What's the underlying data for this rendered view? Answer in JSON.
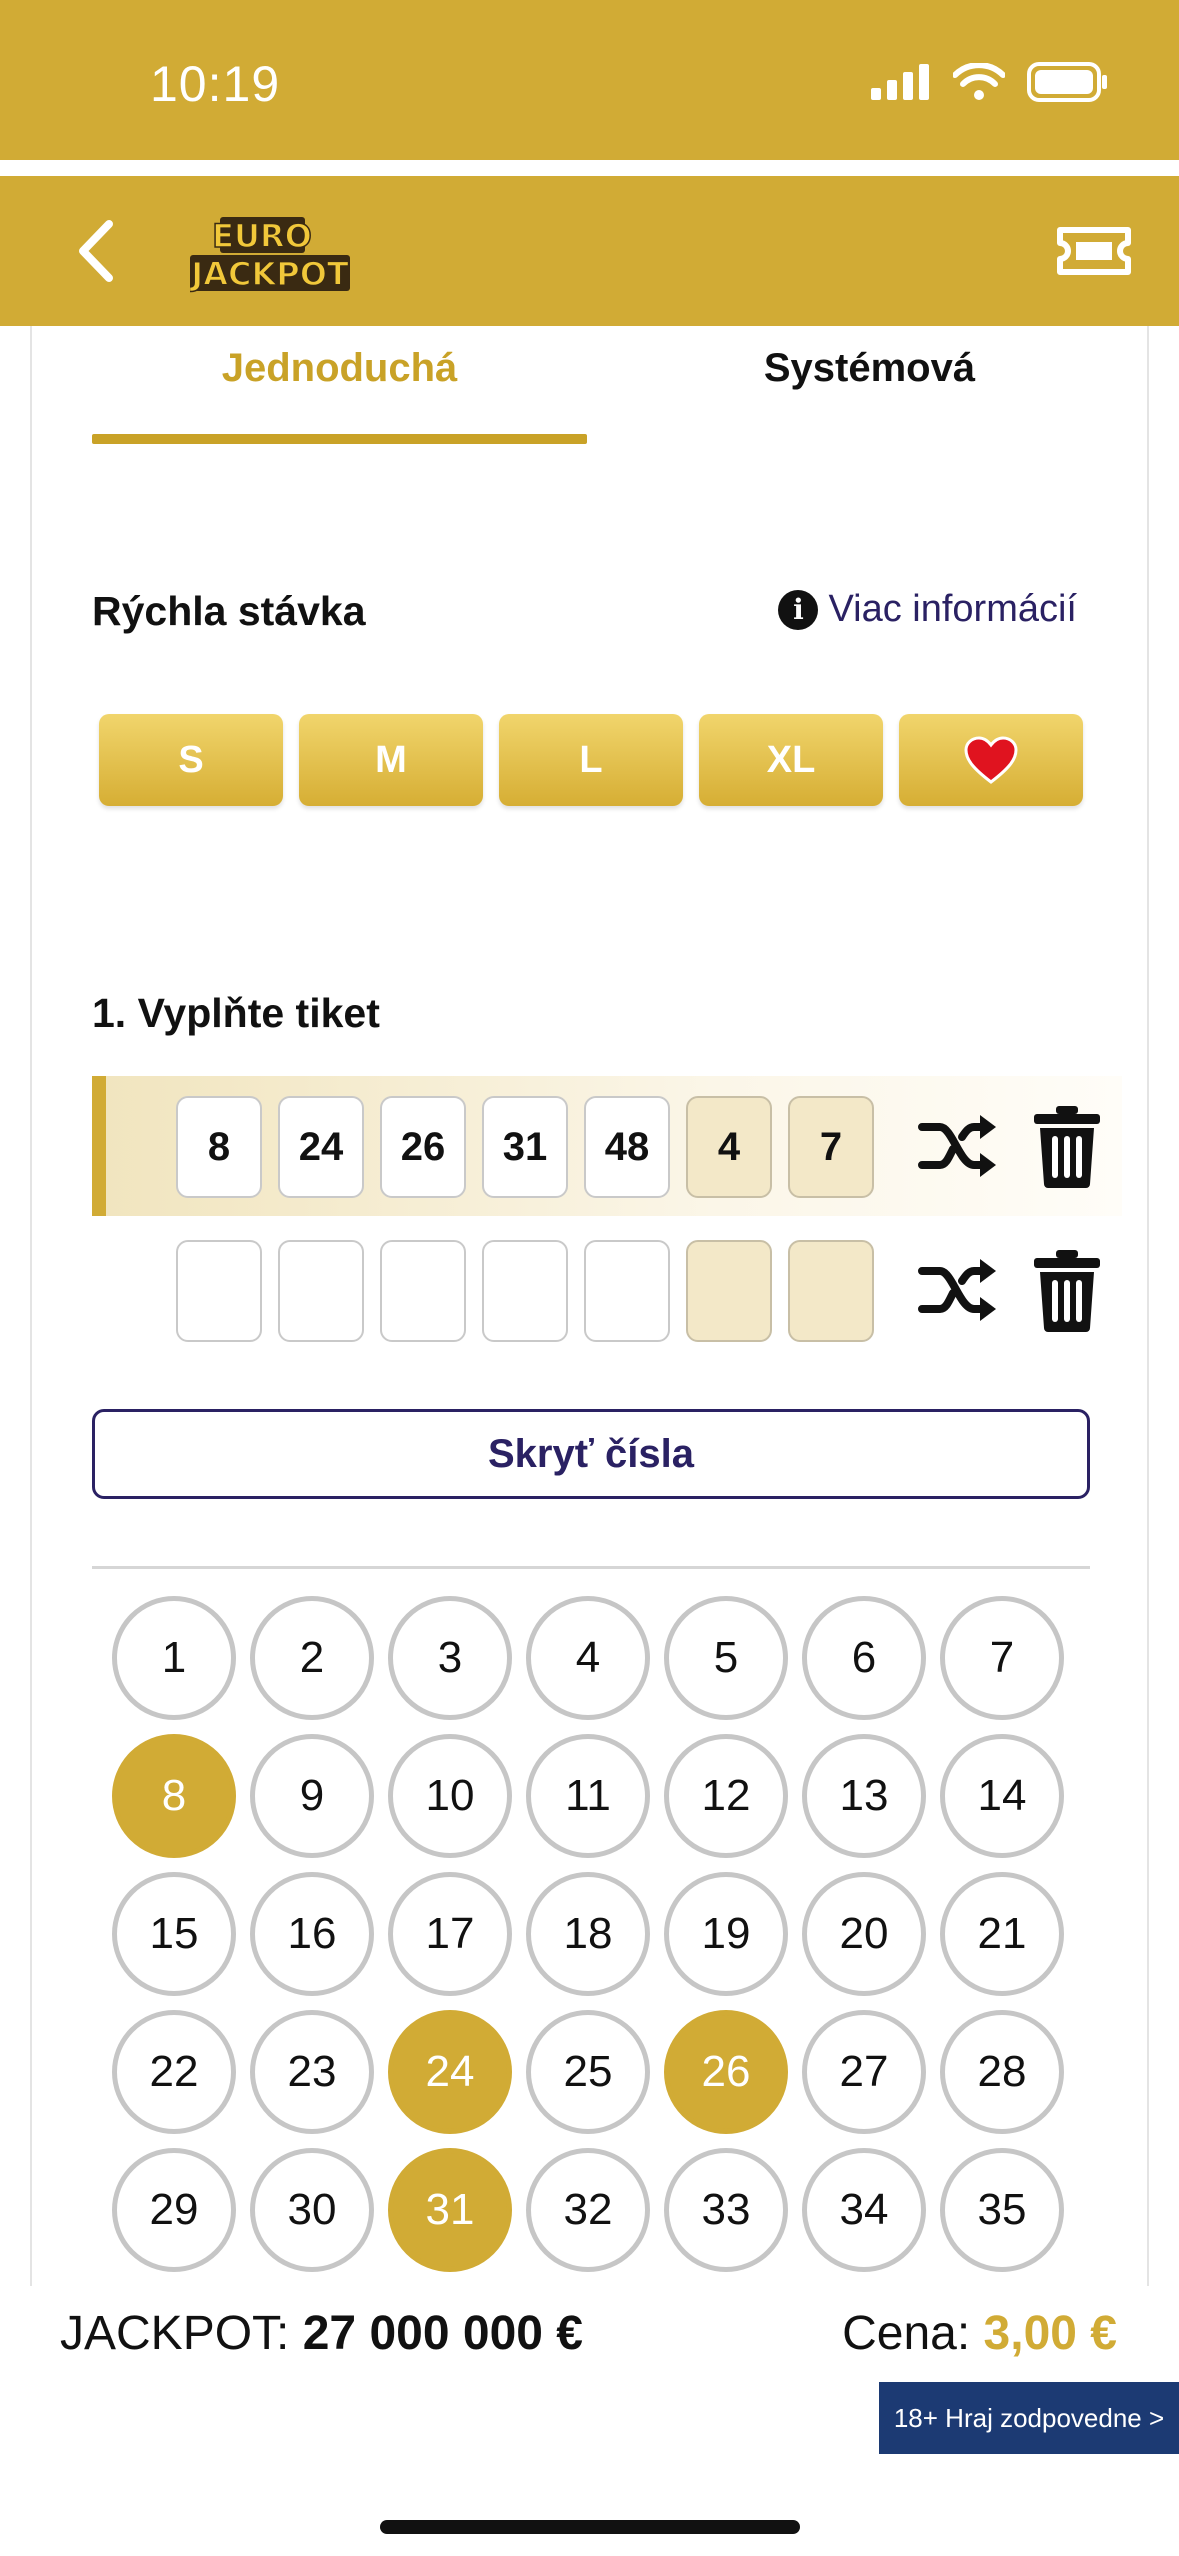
{
  "status_bar": {
    "time": "10:19"
  },
  "header": {
    "logo_line1": "EURO",
    "logo_line2": "JACKPOT"
  },
  "tabs": [
    {
      "label": "Jednoduchá",
      "active": true
    },
    {
      "label": "Systémová",
      "active": false
    }
  ],
  "quick_bet": {
    "title": "Rýchla stávka",
    "info_label": "Viac informácií",
    "sizes": [
      "S",
      "M",
      "L",
      "XL"
    ],
    "favorite_icon": "heart-icon"
  },
  "ticket": {
    "title": "1. Vyplňte tiket",
    "rows": [
      {
        "main": [
          "8",
          "24",
          "26",
          "31",
          "48"
        ],
        "euro": [
          "4",
          "7"
        ]
      },
      {
        "main": [
          "",
          "",
          "",
          "",
          ""
        ],
        "euro": [
          "",
          ""
        ]
      }
    ],
    "hide_label": "Skryť čísla"
  },
  "number_grid": {
    "numbers": [
      "1",
      "2",
      "3",
      "4",
      "5",
      "6",
      "7",
      "8",
      "9",
      "10",
      "11",
      "12",
      "13",
      "14",
      "15",
      "16",
      "17",
      "18",
      "19",
      "20",
      "21",
      "22",
      "23",
      "24",
      "25",
      "26",
      "27",
      "28",
      "29",
      "30",
      "31",
      "32",
      "33",
      "34",
      "35"
    ],
    "selected": [
      "8",
      "24",
      "26",
      "31"
    ]
  },
  "footer": {
    "jackpot_label": "JACKPOT:",
    "jackpot_value": "27 000 000 €",
    "price_label": "Cena:",
    "price_value": "3,00 €",
    "responsible": "18+ Hraj zodpovedne >"
  },
  "colors": {
    "gold": "#d1ab35",
    "navy": "#2a2163",
    "badge": "#1c3a73"
  }
}
